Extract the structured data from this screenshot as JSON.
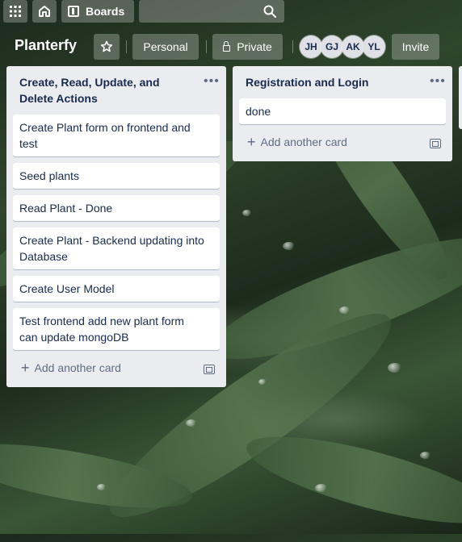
{
  "topbar": {
    "apps_icon": "grid-icon",
    "home_icon": "home-icon",
    "boards_label": "Boards",
    "search_icon": "search-icon"
  },
  "board": {
    "title": "Planterfy",
    "star_icon": "star-icon",
    "workspace_label": "Personal",
    "visibility_label": "Private",
    "members": [
      "JH",
      "GJ",
      "AK",
      "YL"
    ],
    "invite_label": "Invite"
  },
  "lists": [
    {
      "title_line1": "Create, Read, Update, and",
      "title_line2": "Delete Actions",
      "cards": [
        {
          "line1": "Create Plant form on frontend and",
          "line2": "test"
        },
        {
          "line1": "Seed plants",
          "line2": ""
        },
        {
          "line1": "Read Plant - Done",
          "line2": ""
        },
        {
          "line1": "Create Plant - Backend updating into",
          "line2": "Database"
        },
        {
          "line1": "Create User Model",
          "line2": ""
        },
        {
          "line1": "Test frontend add new plant form",
          "line2": "can update mongoDB"
        }
      ],
      "add_card_label": "Add another card"
    },
    {
      "title_line1": "Registration and Login",
      "cards": [
        {
          "line1": "done"
        }
      ],
      "add_card_label": "Add another card"
    }
  ],
  "colors": {
    "list_bg": "#ebecf0",
    "card_bg": "#ffffff",
    "text": "#172b4d",
    "muted": "#5e6c84"
  }
}
